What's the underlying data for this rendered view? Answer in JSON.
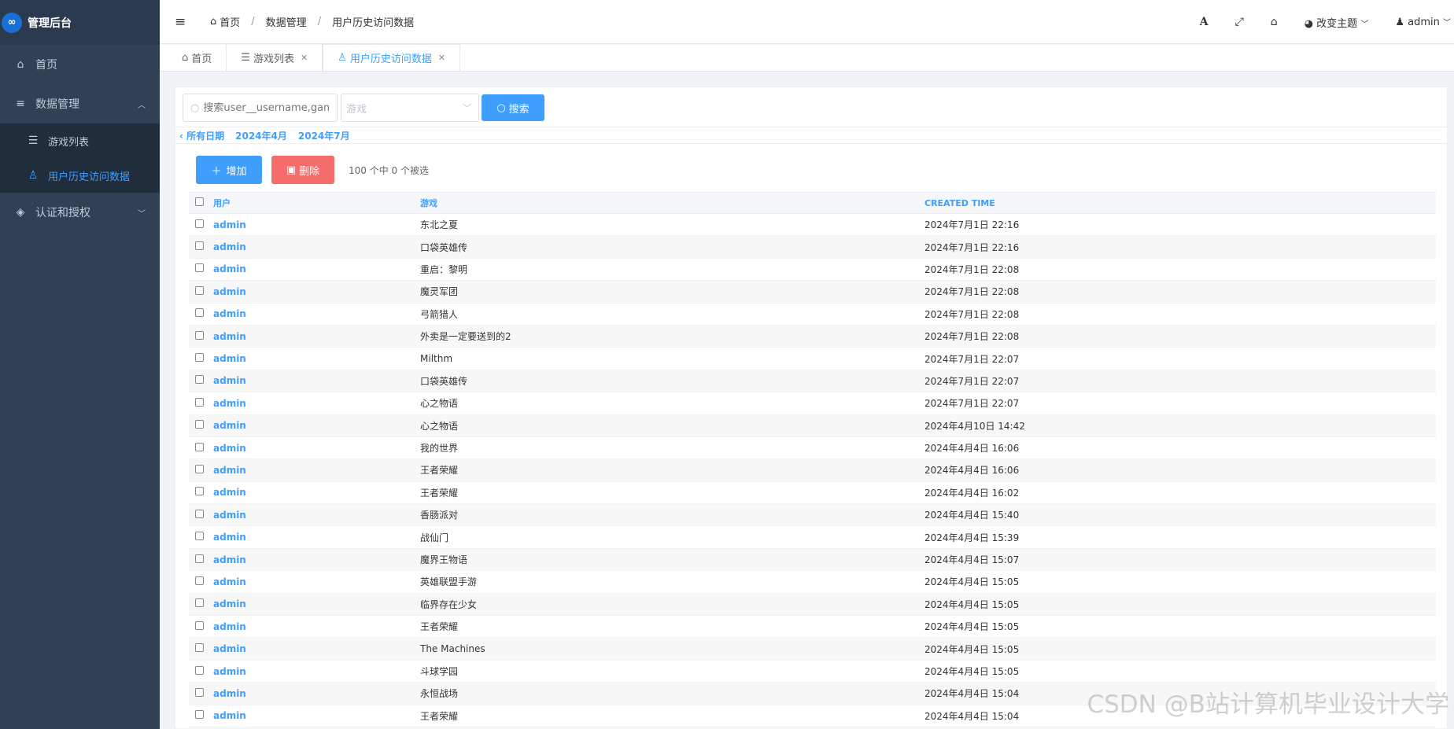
{
  "app": {
    "title": "管理后台",
    "logo": "∞"
  },
  "sidebar": {
    "items": [
      {
        "label": "首页",
        "icon": "home-icon"
      },
      {
        "label": "数据管理",
        "icon": "database-icon",
        "expanded": true
      },
      {
        "label": "游戏列表",
        "icon": "list-icon"
      },
      {
        "label": "用户历史访问数据",
        "icon": "user-icon",
        "active": true
      },
      {
        "label": "认证和授权",
        "icon": "shield-icon"
      }
    ]
  },
  "header": {
    "breadcrumb": [
      "首页",
      "数据管理",
      "用户历史访问数据"
    ],
    "theme_label": "改变主题",
    "user_label": "admin"
  },
  "tabs": [
    {
      "label": "首页",
      "closable": false
    },
    {
      "label": "游戏列表",
      "closable": true
    },
    {
      "label": "用户历史访问数据",
      "closable": true,
      "active": true
    }
  ],
  "search": {
    "placeholder": "搜索user__username,gam",
    "select_placeholder": "游戏",
    "button": "搜索"
  },
  "date_filter": {
    "back": "‹ 所有日期",
    "items": [
      "2024年4月",
      "2024年7月"
    ]
  },
  "actions": {
    "add": "增加",
    "delete": "删除",
    "selection": "100 个中 0 个被选"
  },
  "table": {
    "columns": [
      "用户",
      "游戏",
      "CREATED TIME"
    ],
    "rows": [
      [
        "admin",
        "东北之夏",
        "2024年7月1日 22:16"
      ],
      [
        "admin",
        "口袋英雄传",
        "2024年7月1日 22:16"
      ],
      [
        "admin",
        "重启：黎明",
        "2024年7月1日 22:08"
      ],
      [
        "admin",
        "魔灵军团",
        "2024年7月1日 22:08"
      ],
      [
        "admin",
        "弓箭猎人",
        "2024年7月1日 22:08"
      ],
      [
        "admin",
        "外卖是一定要送到的2",
        "2024年7月1日 22:08"
      ],
      [
        "admin",
        "Milthm",
        "2024年7月1日 22:07"
      ],
      [
        "admin",
        "口袋英雄传",
        "2024年7月1日 22:07"
      ],
      [
        "admin",
        "心之物语",
        "2024年7月1日 22:07"
      ],
      [
        "admin",
        "心之物语",
        "2024年4月10日 14:42"
      ],
      [
        "admin",
        "我的世界",
        "2024年4月4日 16:06"
      ],
      [
        "admin",
        "王者荣耀",
        "2024年4月4日 16:06"
      ],
      [
        "admin",
        "王者荣耀",
        "2024年4月4日 16:02"
      ],
      [
        "admin",
        "香肠派对",
        "2024年4月4日 15:40"
      ],
      [
        "admin",
        "战仙门",
        "2024年4月4日 15:39"
      ],
      [
        "admin",
        "魔界王物语",
        "2024年4月4日 15:07"
      ],
      [
        "admin",
        "英雄联盟手游",
        "2024年4月4日 15:05"
      ],
      [
        "admin",
        "临界存在少女",
        "2024年4月4日 15:05"
      ],
      [
        "admin",
        "王者荣耀",
        "2024年4月4日 15:05"
      ],
      [
        "admin",
        "The Machines",
        "2024年4月4日 15:05"
      ],
      [
        "admin",
        "斗球学园",
        "2024年4月4日 15:05"
      ],
      [
        "admin",
        "永恒战场",
        "2024年4月4日 15:04"
      ],
      [
        "admin",
        "王者荣耀",
        "2024年4月4日 15:04"
      ]
    ]
  },
  "watermark": "CSDN @B站计算机毕业设计大学"
}
